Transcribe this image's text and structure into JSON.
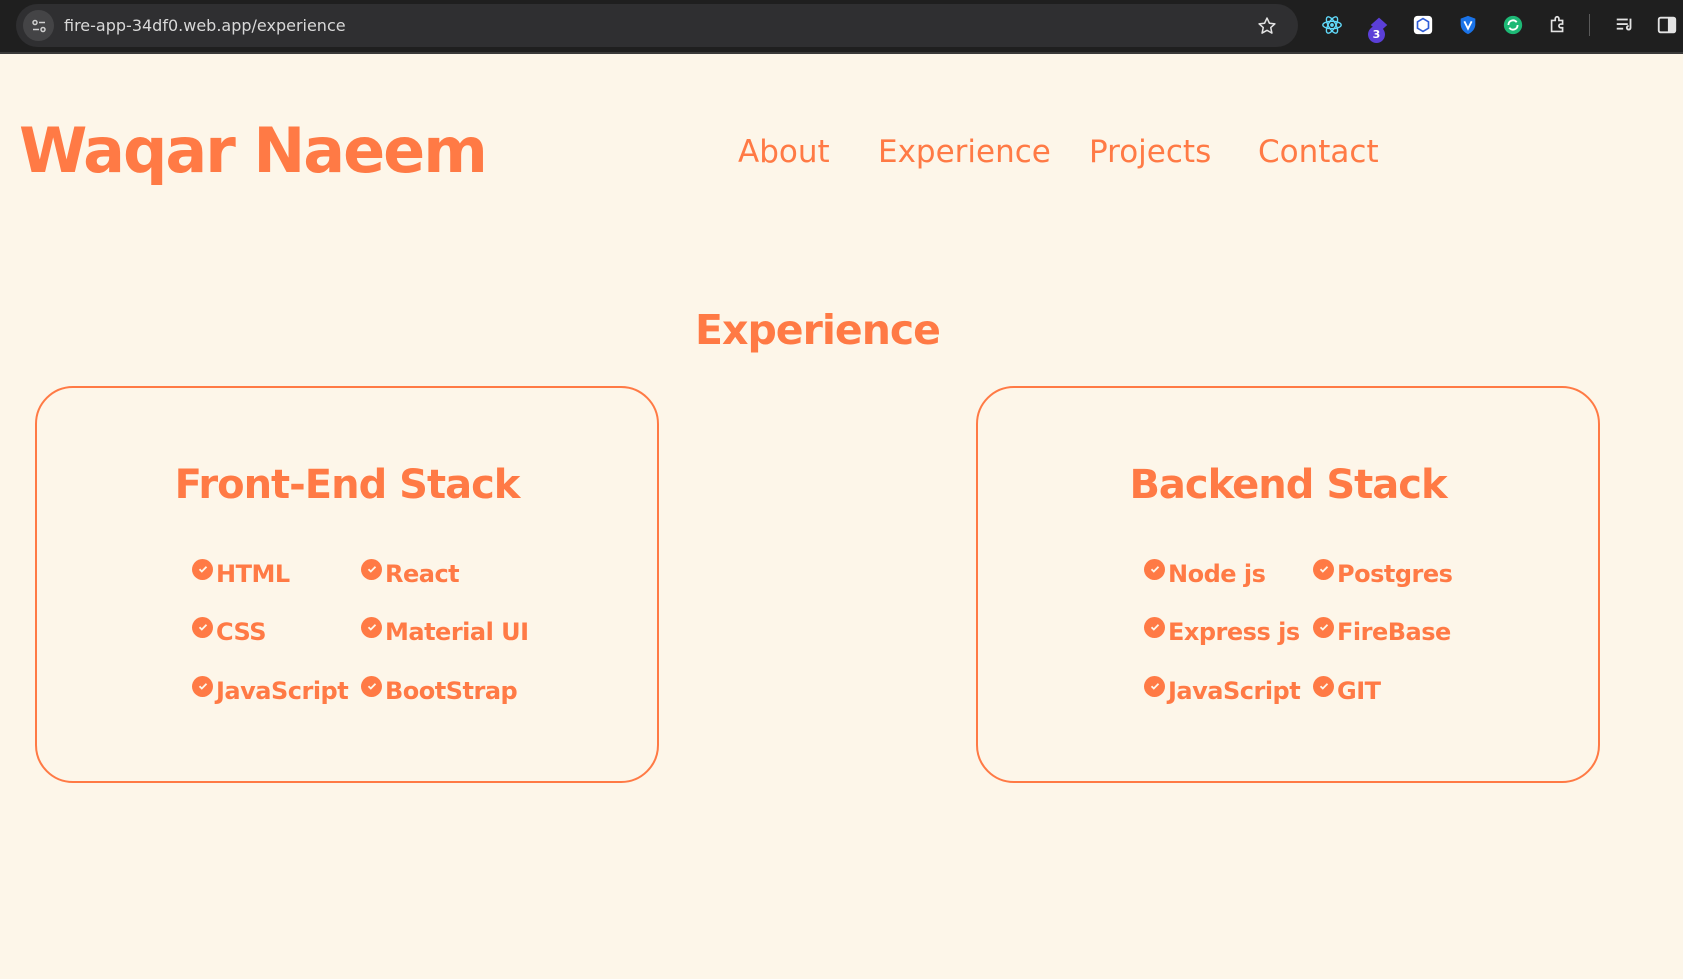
{
  "browser": {
    "url": "fire-app-34df0.web.app/experience",
    "extension_badge": "3",
    "colors": {
      "chrome": "#1f1f1f",
      "omnibox": "#2f2f31"
    }
  },
  "header": {
    "brand": "Waqar Naeem",
    "nav": [
      {
        "label": "About"
      },
      {
        "label": "Experience"
      },
      {
        "label": "Projects"
      },
      {
        "label": "Contact"
      }
    ]
  },
  "experience": {
    "title": "Experience",
    "cards": [
      {
        "title": "Front-End Stack",
        "skills": [
          "HTML",
          "React",
          "CSS",
          "Material UI",
          "JavaScript",
          "BootStrap"
        ]
      },
      {
        "title": "Backend Stack",
        "skills": [
          "Node js",
          "Postgres",
          "Express js",
          "FireBase",
          "JavaScript",
          "GIT"
        ]
      }
    ]
  },
  "colors": {
    "accent": "#ff7a45",
    "background": "#fdf6e9"
  }
}
